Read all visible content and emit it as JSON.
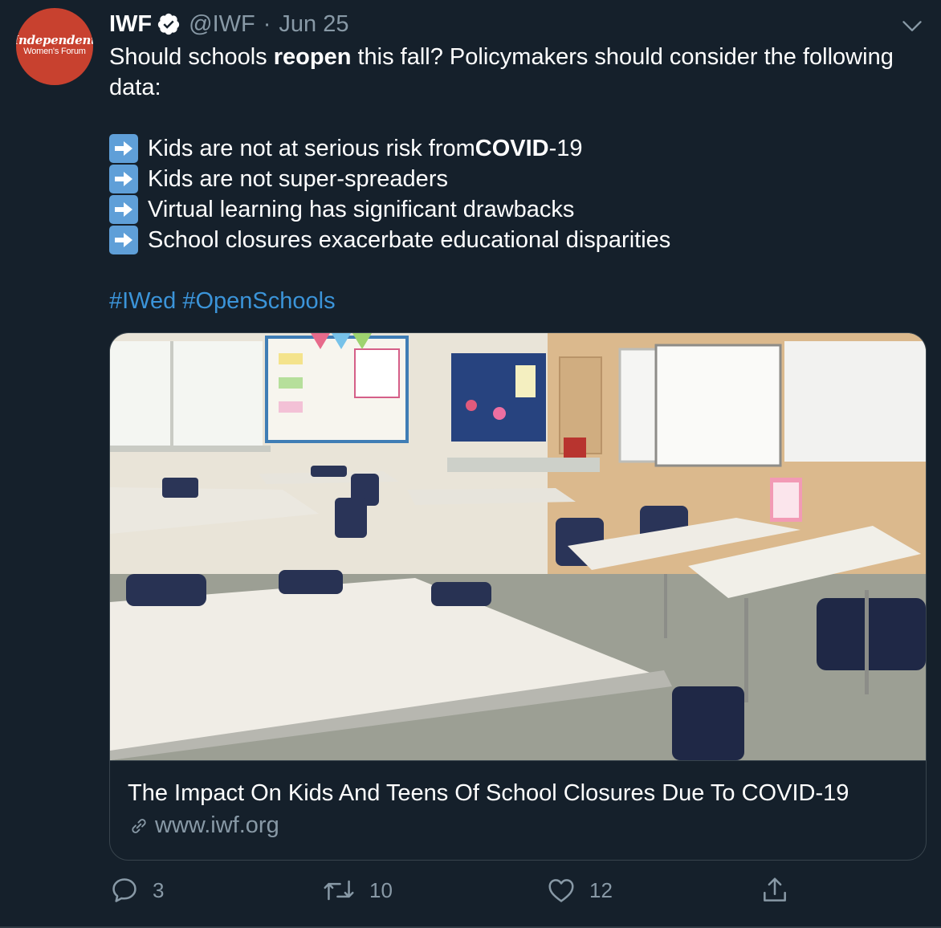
{
  "avatar": {
    "logo_top": "Independent",
    "logo_bottom": "Women's Forum",
    "color": "#c8412f"
  },
  "header": {
    "name": "IWF",
    "handle": "@IWF",
    "separator": "·",
    "date": "Jun 25",
    "verified_icon": "verified-badge-icon",
    "menu_icon": "chevron-down-icon"
  },
  "body": {
    "line1_pre": "Should schools ",
    "line1_bold": "reopen",
    "line1_post": " this fall? Policymakers should consider the following data:",
    "bullets": [
      {
        "pre": "Kids are not at serious risk from ",
        "bold": "COVID",
        "post": "-19"
      },
      {
        "pre": "Kids are not super-spreaders",
        "bold": "",
        "post": ""
      },
      {
        "pre": "Virtual learning has significant drawbacks",
        "bold": "",
        "post": ""
      },
      {
        "pre": "School closures exacerbate educational disparities",
        "bold": "",
        "post": ""
      }
    ],
    "bullet_icon": "right-arrow-emoji-icon",
    "hashtags": [
      "#IWed",
      "#OpenSchools"
    ]
  },
  "card": {
    "image_subject": "empty-classroom-photo",
    "title": "The Impact On Kids And Teens Of School Closures Due To COVID-19",
    "domain": "www.iwf.org",
    "link_icon": "link-icon"
  },
  "actions": {
    "reply_count": "3",
    "retweet_count": "10",
    "like_count": "12"
  },
  "colors": {
    "background": "#15202b",
    "text_secondary": "#8899a6",
    "link": "#3b94d9",
    "border": "#38444d"
  }
}
